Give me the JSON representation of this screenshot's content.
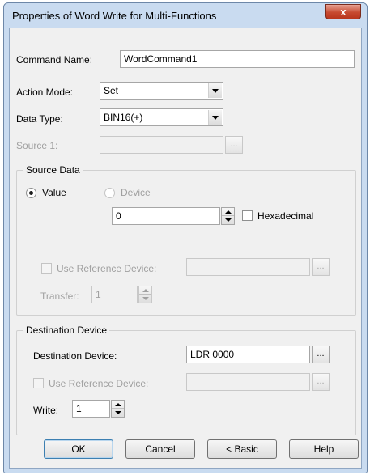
{
  "window": {
    "title": "Properties of Word Write for Multi-Functions",
    "close_label": "x"
  },
  "command_name": {
    "label": "Command Name:",
    "value": "WordCommand1"
  },
  "action_mode": {
    "label": "Action Mode:",
    "value": "Set"
  },
  "data_type": {
    "label": "Data Type:",
    "value": "BIN16(+)"
  },
  "source1": {
    "label": "Source 1:",
    "value": "",
    "browse": "..."
  },
  "source_data": {
    "title": "Source Data",
    "value_radio": "Value",
    "device_radio": "Device",
    "value": "0",
    "hexadecimal": "Hexadecimal",
    "use_reference_device": "Use Reference Device:",
    "reference_value": "",
    "browse": "...",
    "transfer_label": "Transfer:",
    "transfer_value": "1"
  },
  "destination": {
    "title": "Destination Device",
    "device_label": "Destination Device:",
    "device_value": "LDR 0000",
    "browse": "...",
    "use_reference_device": "Use Reference Device:",
    "reference_value": "",
    "ref_browse": "...",
    "write_label": "Write:",
    "write_value": "1"
  },
  "buttons": {
    "ok": "OK",
    "cancel": "Cancel",
    "basic": "< Basic",
    "help": "Help"
  }
}
